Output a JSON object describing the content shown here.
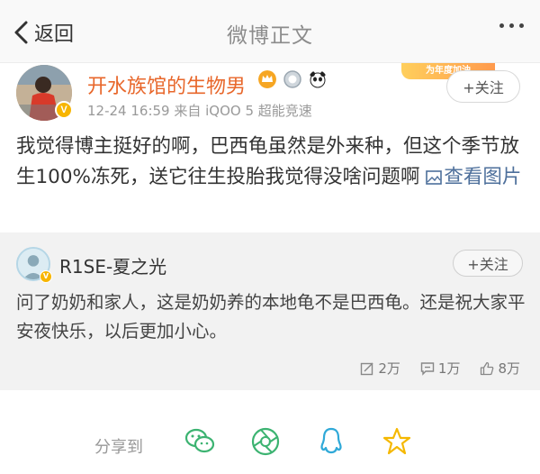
{
  "nav": {
    "back_label": "返回",
    "title": "微博正文"
  },
  "post": {
    "username": "开水族馆的生物男",
    "meta": "12-24 16:59  来自 iQOO 5 超能竞速",
    "follow_label": "+关注",
    "promo_text": "为年度加油",
    "text": "我觉得博主挺好的啊，巴西龟虽然是外来种，但这个季节放生100%冻死，送它往生投胎我觉得没啥问题啊",
    "view_image_label": "查看图片"
  },
  "repost": {
    "username": "R1SE-夏之光",
    "follow_label": "+关注",
    "text": "问了奶奶和家人，这是奶奶养的本地龟不是巴西龟。还是祝大家平安夜快乐，以后更加小心。",
    "stats": {
      "reposts": "2万",
      "comments": "1万",
      "likes": "8万"
    }
  },
  "share": {
    "label": "分享到",
    "targets": [
      "wechat-icon",
      "moments-icon",
      "qq-icon",
      "qzone-icon"
    ]
  },
  "colors": {
    "username": "#e8672b",
    "link": "#4d6f9b",
    "share_icon": "#3cb371",
    "qzone": "#f5b800"
  }
}
